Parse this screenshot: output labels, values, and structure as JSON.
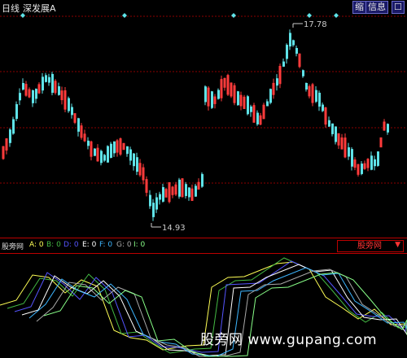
{
  "header": {
    "period": "日线",
    "instrument": "深发展A",
    "btn_zoom": "缩",
    "btn_info": "信息",
    "btn_close": "☐"
  },
  "main_chart": {
    "type": "candlestick",
    "high_label": "17.78",
    "low_label": "14.93",
    "colors": {
      "up": "#ff3b3b",
      "down": "#5fe3e8",
      "grid": "#8b0000"
    }
  },
  "indicator": {
    "name": "股旁网",
    "params": [
      {
        "label": "A: 0",
        "color": "#ffff55"
      },
      {
        "label": "B: 0",
        "color": "#44bb44"
      },
      {
        "label": "D: 0",
        "color": "#5555ff"
      },
      {
        "label": "E: 0",
        "color": "#ffffff"
      },
      {
        "label": "F: 0",
        "color": "#3db6ff"
      },
      {
        "label": "G: 0",
        "color": "#aaaaaa"
      },
      {
        "label": "I: 0",
        "color": "#88ff88"
      }
    ],
    "dropdown_label": "股旁网",
    "dropdown_icon": "triangle-down"
  },
  "watermark": "股旁网 www.gupang.com"
}
